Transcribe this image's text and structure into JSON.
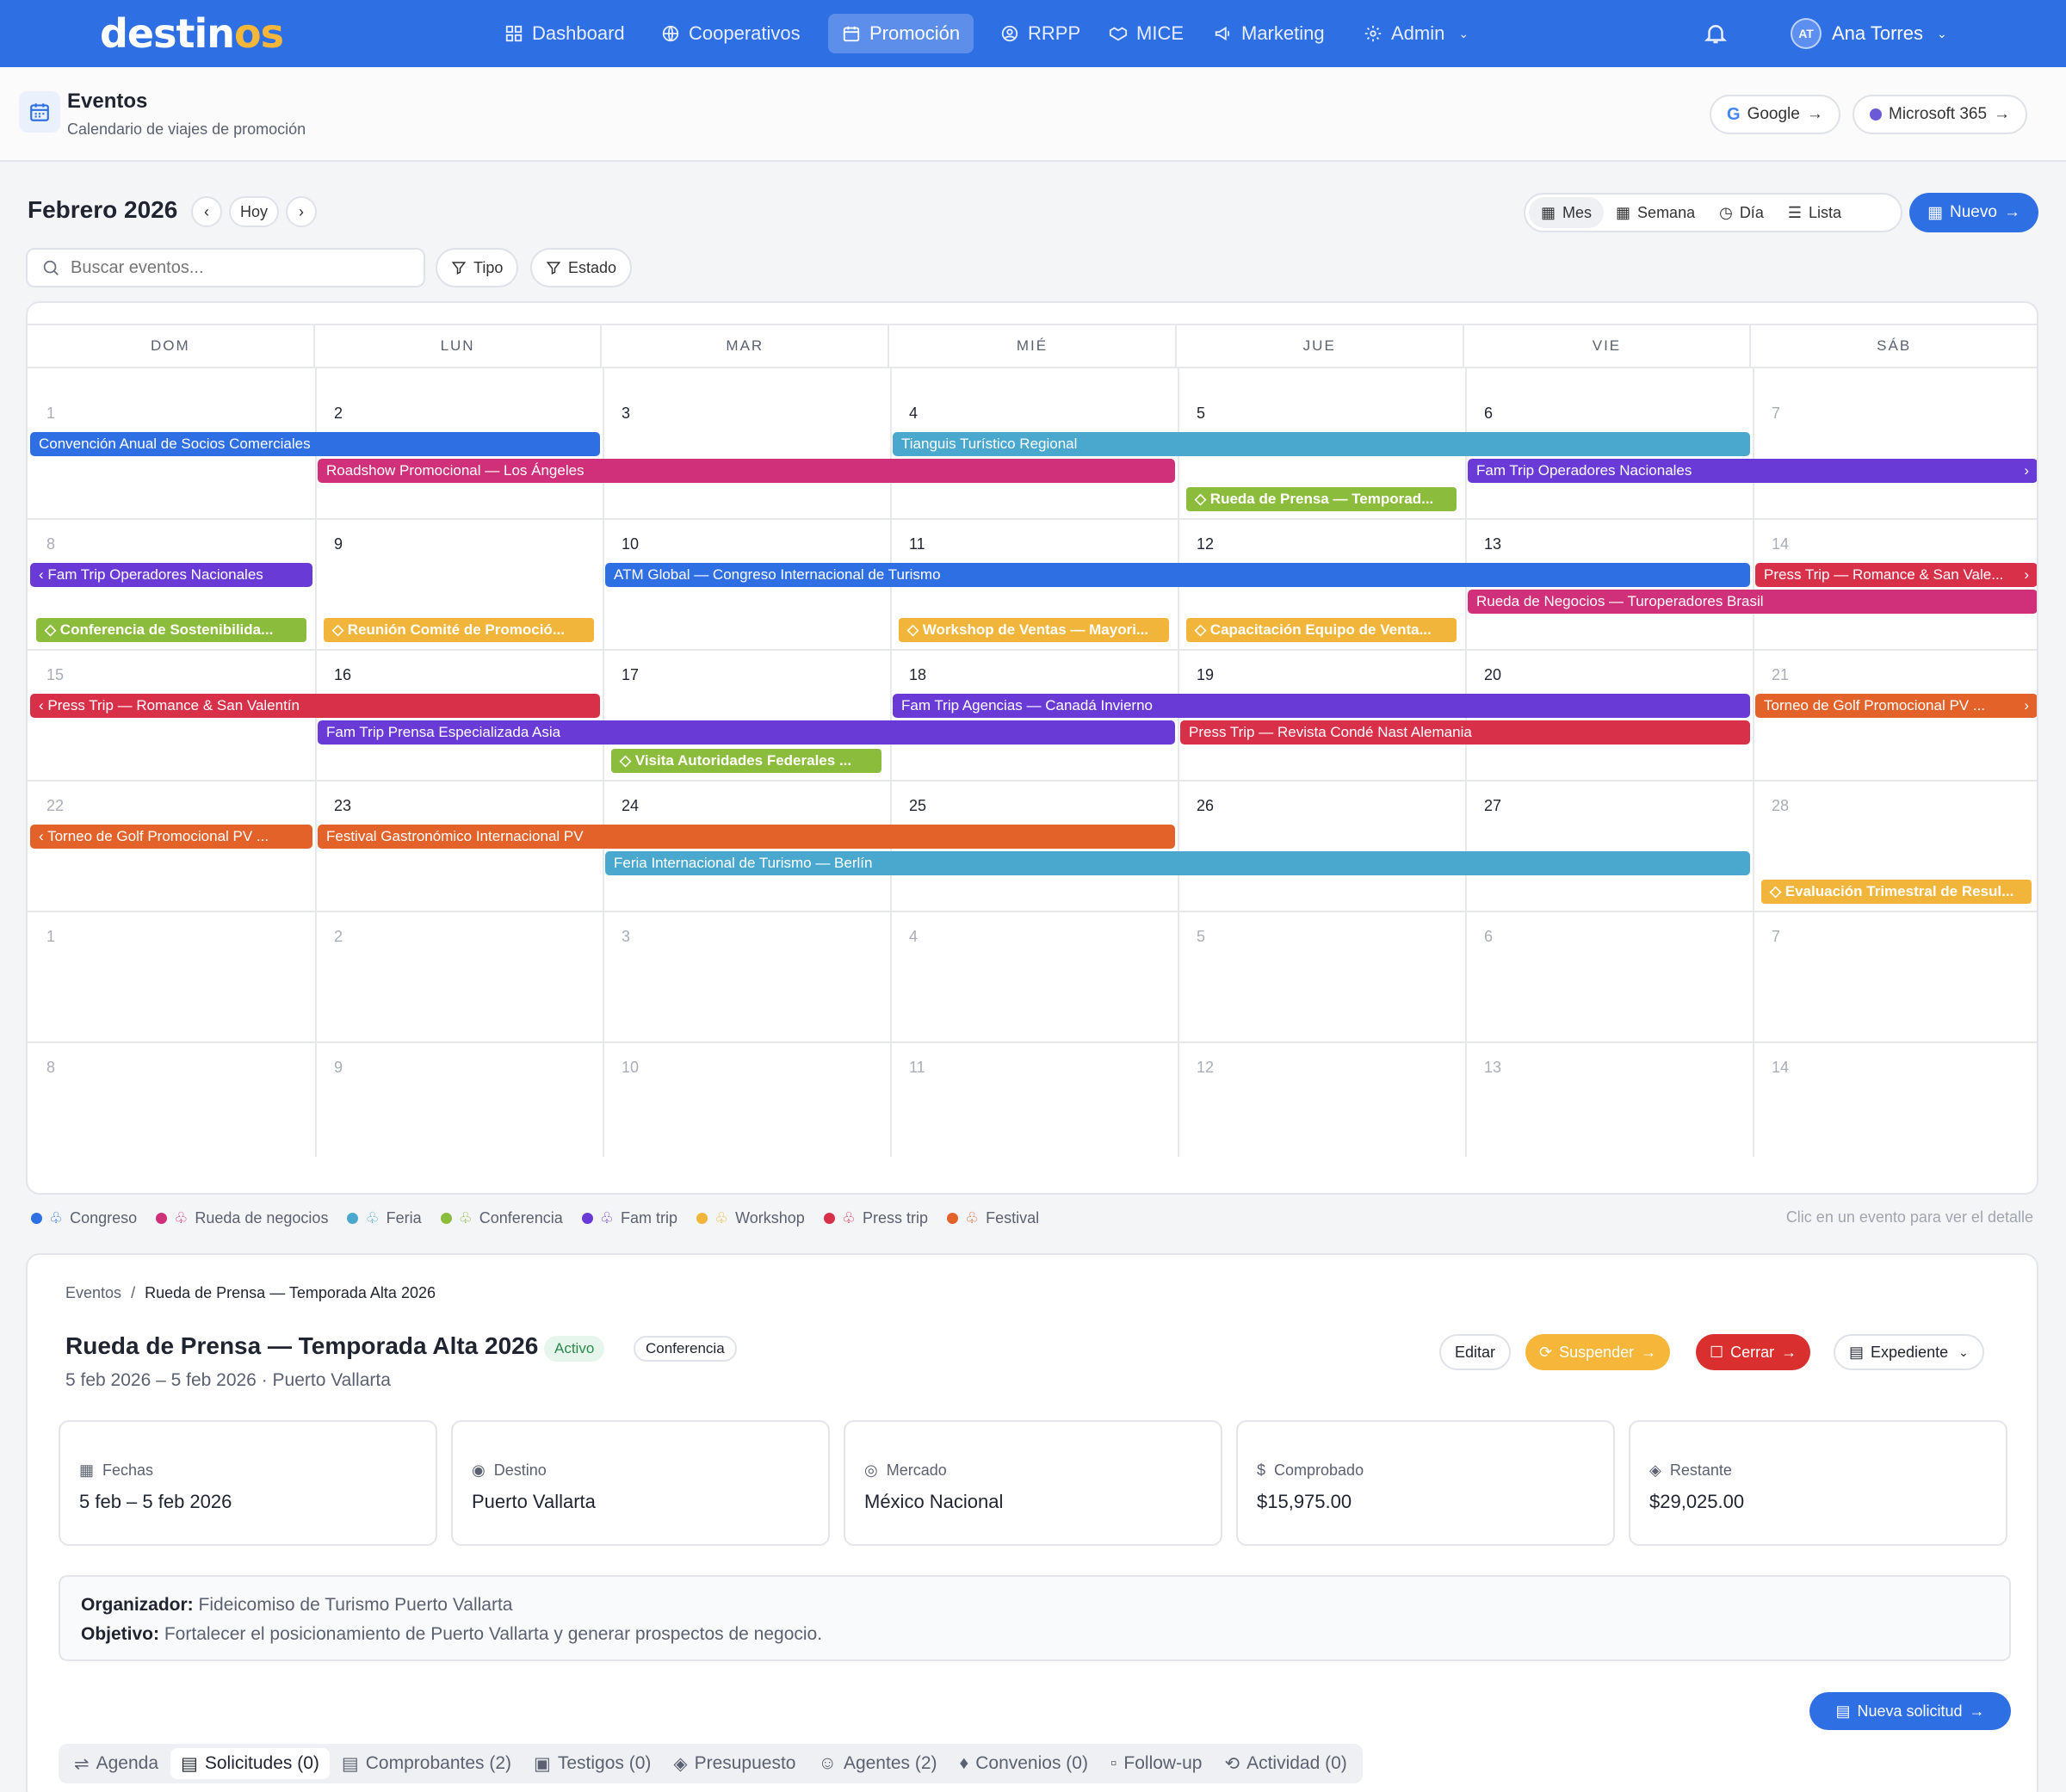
{
  "app": {
    "logo_main": "destin",
    "logo_accent": "os",
    "nav": [
      {
        "label": "Dashboard",
        "icon": "grid-icon"
      },
      {
        "label": "Cooperativos",
        "icon": "globe-icon"
      },
      {
        "label": "Promoción",
        "icon": "calendar-icon",
        "active": true
      },
      {
        "label": "RRPP",
        "icon": "user-circle-icon"
      },
      {
        "label": "MICE",
        "icon": "handshake-icon"
      },
      {
        "label": "Marketing",
        "icon": "megaphone-icon"
      },
      {
        "label": "Admin",
        "icon": "gear-icon"
      }
    ],
    "user": {
      "initials": "AT",
      "name": "Ana Torres"
    }
  },
  "page": {
    "title": "Eventos",
    "subtitle": "Calendario de viajes de promoción",
    "sync": [
      {
        "label": "Google"
      },
      {
        "label": "Microsoft 365"
      }
    ]
  },
  "toolbar": {
    "month": "Febrero 2026",
    "today": "Hoy",
    "views": [
      "Mes",
      "Semana",
      "Día",
      "Lista"
    ],
    "active_view": "Mes",
    "new_label": "Nuevo",
    "search_placeholder": "Buscar eventos...",
    "filters": [
      "Tipo",
      "Estado"
    ]
  },
  "calendar": {
    "weekdays": [
      "DOM",
      "LUN",
      "MAR",
      "MIÉ",
      "JUE",
      "VIE",
      "SÁB"
    ],
    "weeks": [
      [
        "1",
        "2",
        "3",
        "4",
        "5",
        "6",
        "7"
      ],
      [
        "8",
        "9",
        "10",
        "11",
        "12",
        "13",
        "14"
      ],
      [
        "15",
        "16",
        "17",
        "18",
        "19",
        "20",
        "21"
      ],
      [
        "22",
        "23",
        "24",
        "25",
        "26",
        "27",
        "28"
      ],
      [
        "1",
        "2",
        "3",
        "4",
        "5",
        "6",
        "7"
      ],
      [
        "8",
        "9",
        "10",
        "11",
        "12",
        "13",
        "14"
      ]
    ],
    "events": [
      {
        "title": "Convención Anual de Socios Comerciales",
        "type": "Congreso"
      },
      {
        "title": "Tianguis Turístico Regional",
        "type": "Feria"
      },
      {
        "title": "Roadshow Promocional — Los Ángeles",
        "type": "Rueda de negocios"
      },
      {
        "title": "Fam Trip Operadores Nacionales",
        "type": "Fam trip"
      },
      {
        "title": "Rueda de Prensa — Temporad...",
        "type": "Conferencia"
      },
      {
        "title": "Fam Trip Operadores Nacionales",
        "type": "Fam trip"
      },
      {
        "title": "ATM Global — Congreso Internacional de Turismo",
        "type": "Congreso"
      },
      {
        "title": "Press Trip — Romance & San Vale...",
        "type": "Press trip"
      },
      {
        "title": "Rueda de Negocios — Turoperadores Brasil",
        "type": "Rueda de negocios"
      },
      {
        "title": "Conferencia de Sostenibilida...",
        "type": "Conferencia"
      },
      {
        "title": "Reunión Comité de Promoció...",
        "type": "Workshop"
      },
      {
        "title": "Workshop de Ventas — Mayori...",
        "type": "Workshop"
      },
      {
        "title": "Capacitación Equipo de Venta...",
        "type": "Workshop"
      },
      {
        "title": "Press Trip — Romance & San Valentín",
        "type": "Press trip"
      },
      {
        "title": "Fam Trip Agencias — Canadá Invierno",
        "type": "Fam trip"
      },
      {
        "title": "Torneo de Golf Promocional PV ...",
        "type": "Festival"
      },
      {
        "title": "Fam Trip Prensa Especializada Asia",
        "type": "Fam trip"
      },
      {
        "title": "Press Trip — Revista Condé Nast Alemania",
        "type": "Press trip"
      },
      {
        "title": "Visita Autoridades Federales ...",
        "type": "Conferencia"
      },
      {
        "title": "Torneo de Golf Promocional PV ...",
        "type": "Festival"
      },
      {
        "title": "Festival Gastronómico Internacional PV",
        "type": "Festival"
      },
      {
        "title": "Feria Internacional de Turismo — Berlín",
        "type": "Feria"
      },
      {
        "title": "Evaluación Trimestral de Resul...",
        "type": "Workshop"
      }
    ]
  },
  "legend": {
    "items": [
      {
        "label": "Congreso",
        "color": "#2f6fe4"
      },
      {
        "label": "Rueda de negocios",
        "color": "#d0307a"
      },
      {
        "label": "Feria",
        "color": "#4aa8cf"
      },
      {
        "label": "Conferencia",
        "color": "#8cbc3c"
      },
      {
        "label": "Fam trip",
        "color": "#6a3ad6"
      },
      {
        "label": "Workshop",
        "color": "#f0b53a"
      },
      {
        "label": "Press trip",
        "color": "#d9304a"
      },
      {
        "label": "Festival",
        "color": "#e2622a"
      }
    ],
    "hint": "Clic en un evento para ver el detalle"
  },
  "detail": {
    "breadcrumb_root": "Eventos",
    "breadcrumb_sep": "/",
    "breadcrumb_current": "Rueda de Prensa — Temporada Alta 2026",
    "title": "Rueda de Prensa — Temporada Alta 2026",
    "status": "Activo",
    "type": "Conferencia",
    "subtitle": "5 feb 2026 – 5 feb 2026 · Puerto Vallarta",
    "actions": {
      "edit": "Editar",
      "suspend": "Suspender",
      "close": "Cerrar",
      "file": "Expediente"
    },
    "kpis": [
      {
        "label": "Fechas",
        "value": "5 feb – 5 feb 2026",
        "icon": "calendar-icon"
      },
      {
        "label": "Destino",
        "value": "Puerto Vallarta",
        "icon": "map-pin-icon"
      },
      {
        "label": "Mercado",
        "value": "México Nacional",
        "icon": "globe-icon"
      },
      {
        "label": "Comprobado",
        "value": "$15,975.00",
        "icon": "dollar-icon"
      },
      {
        "label": "Restante",
        "value": "$29,025.00",
        "icon": "piggy-bank-icon"
      }
    ],
    "organizer_label": "Organizador:",
    "organizer": "Fideicomiso de Turismo Puerto Vallarta",
    "objective_label": "Objetivo:",
    "objective": "Fortalecer el posicionamiento de Puerto Vallarta y generar prospectos de negocio.",
    "new_request": "Nueva solicitud",
    "tabs": [
      {
        "label": "Agenda"
      },
      {
        "label": "Solicitudes (0)",
        "active": true
      },
      {
        "label": "Comprobantes (2)"
      },
      {
        "label": "Testigos (0)"
      },
      {
        "label": "Presupuesto"
      },
      {
        "label": "Agentes (2)"
      },
      {
        "label": "Convenios (0)"
      },
      {
        "label": "Follow-up"
      },
      {
        "label": "Actividad (0)"
      }
    ]
  }
}
